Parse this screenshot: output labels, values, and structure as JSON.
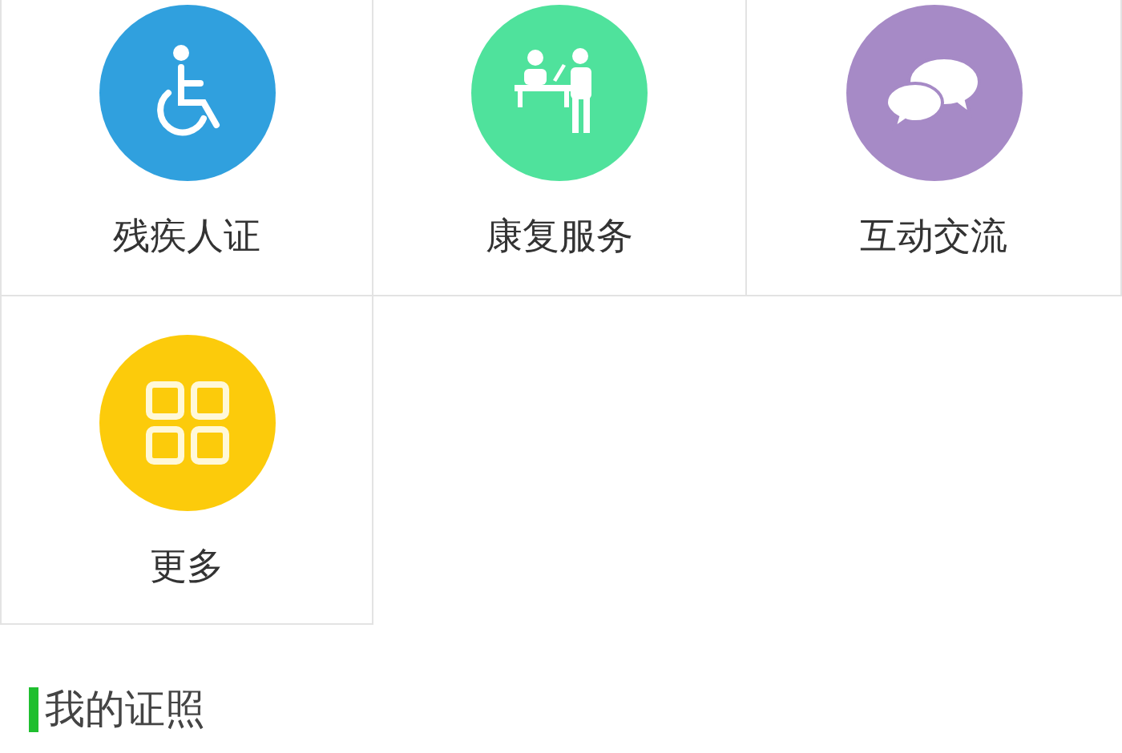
{
  "services": [
    {
      "label": "残疾人证",
      "kind": "wheelchair",
      "color": "#30a0de"
    },
    {
      "label": "康复服务",
      "kind": "reception",
      "color": "#4fe29c"
    },
    {
      "label": "互动交流",
      "kind": "chat",
      "color": "#a68ac6"
    },
    {
      "label": "更多",
      "kind": "grid",
      "color": "#fccb0b"
    }
  ],
  "section": {
    "title": "我的证照"
  }
}
